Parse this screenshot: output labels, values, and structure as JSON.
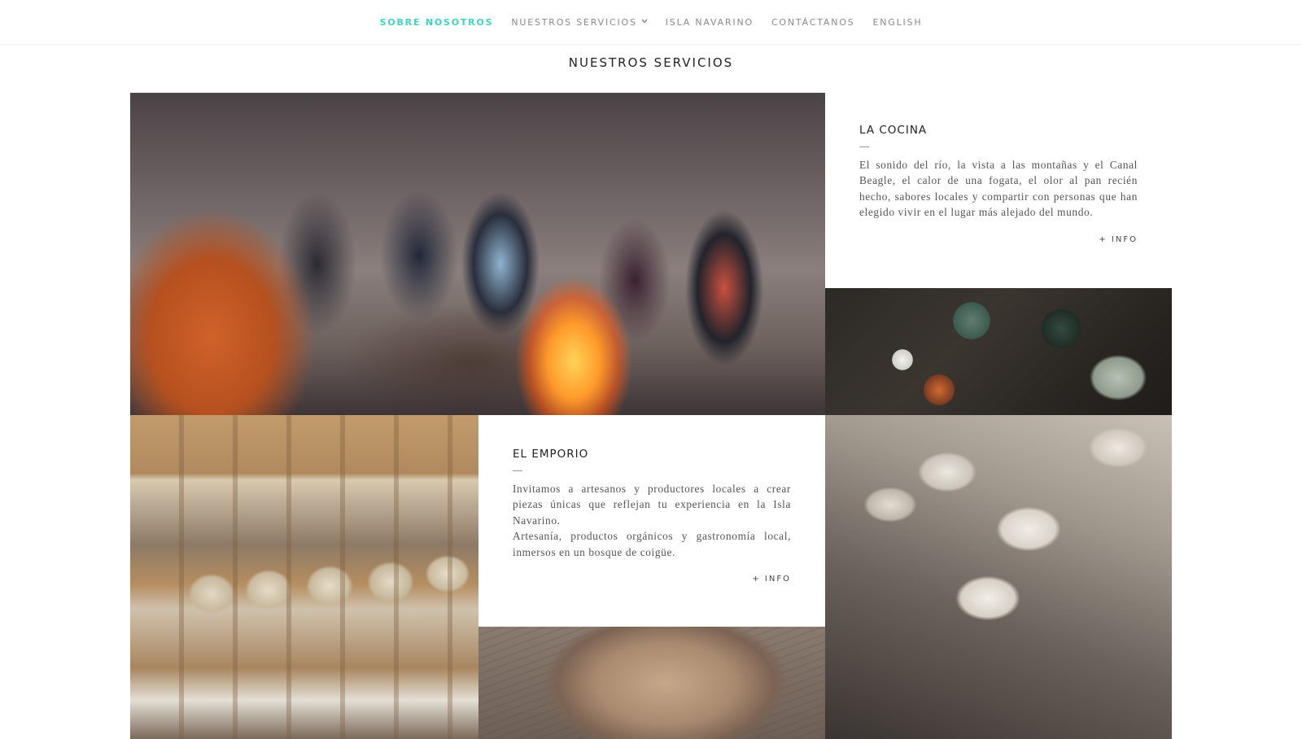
{
  "nav": {
    "items": [
      {
        "label": "SOBRE NOSOTROS",
        "active": true
      },
      {
        "label": "NUESTROS SERVICIOS",
        "has_dropdown": true
      },
      {
        "label": "ISLA NAVARINO"
      },
      {
        "label": "CONTÁCTANOS"
      },
      {
        "label": "ENGLISH"
      }
    ],
    "dropdown_icon": "chevron-down-icon",
    "active_color": "#3fd3c0"
  },
  "section": {
    "title": "NUESTROS SERVICIOS"
  },
  "cards": {
    "cocina": {
      "title": "LA COCINA",
      "text": "El sonido del río, la vista a las montañas y el Canal Beagle, el calor de una fogata, el olor al pan recién hecho, sabores locales y compartir con personas que han elegido vivir en el lugar más alejado del mundo.",
      "more": "+ INFO"
    },
    "emporio": {
      "title": "EL EMPORIO",
      "text_1": "Invitamos a artesanos y productores locales a crear piezas únicas que reflejan tu experiencia en la Isla Navarino.",
      "text_2": "Artesanía, productos orgánicos y gastronomía local, inmersos en un bosque de coigüe.",
      "more": "+ INFO"
    }
  }
}
